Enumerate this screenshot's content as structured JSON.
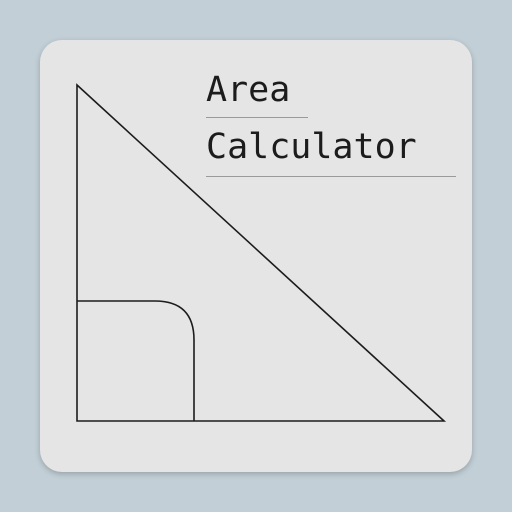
{
  "icon": {
    "title_line_1": "Area",
    "title_line_2": "Calculator",
    "shapes": [
      "right-triangle",
      "right-angle-marker"
    ]
  },
  "colors": {
    "background": "#c2cfd6",
    "card": "#e5e5e5",
    "stroke": "#1c1c1c",
    "rule": "#9a9a9a"
  }
}
